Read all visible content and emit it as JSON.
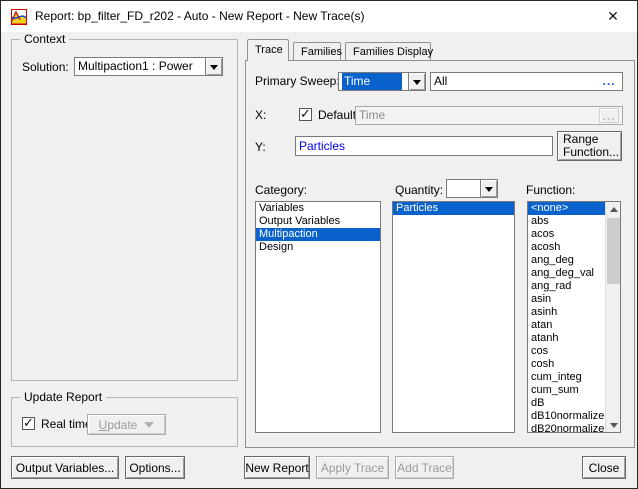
{
  "window": {
    "title": "Report: bp_filter_FD_r202 - Auto - New Report - New Trace(s)"
  },
  "icons": {
    "close": "✕",
    "check": "✓",
    "ellipsis": "..."
  },
  "colors": {
    "selection_blue": "#0a63cd",
    "value_blue": "#0000ee",
    "dialog_bg": "#f0f0f0"
  },
  "context": {
    "group_label": "Context",
    "solution_label": "Solution:",
    "solution_value": "Multipaction1 : Power"
  },
  "tabs": [
    {
      "label": "Trace"
    },
    {
      "label": "Families"
    },
    {
      "label": "Families Display"
    }
  ],
  "trace": {
    "primary_sweep_label": "Primary Sweep:",
    "primary_sweep_value": "Time",
    "sweep_range_value": "All",
    "x_label": "X:",
    "default_label": "Default",
    "x_value": "Time",
    "y_label": "Y:",
    "y_value": "Particles",
    "range_function_line1": "Range",
    "range_function_line2": "Function...",
    "category": {
      "label": "Category:",
      "items": [
        "Variables",
        "Output Variables",
        "Multipaction",
        "Design"
      ],
      "selected": "Multipaction"
    },
    "quantity": {
      "label": "Quantity:",
      "dropdown_value": "",
      "items": [
        "Particles"
      ],
      "selected": "Particles"
    },
    "function": {
      "label": "Function:",
      "items": [
        "<none>",
        "abs",
        "acos",
        "acosh",
        "ang_deg",
        "ang_deg_val",
        "ang_rad",
        "asin",
        "asinh",
        "atan",
        "atanh",
        "cos",
        "cosh",
        "cum_integ",
        "cum_sum",
        "dB",
        "dB10normalize",
        "dB20normalize"
      ],
      "selected": "<none>"
    }
  },
  "update_report": {
    "group_label": "Update Report",
    "real_time_label": "Real time",
    "real_time_checked": true,
    "update_first": "U",
    "update_rest": "pdate"
  },
  "footer": {
    "output_variables": "Output Variables...",
    "options": "Options...",
    "new_report": "New Report",
    "apply_trace": "Apply Trace",
    "add_trace": "Add Trace",
    "close": "Close"
  }
}
